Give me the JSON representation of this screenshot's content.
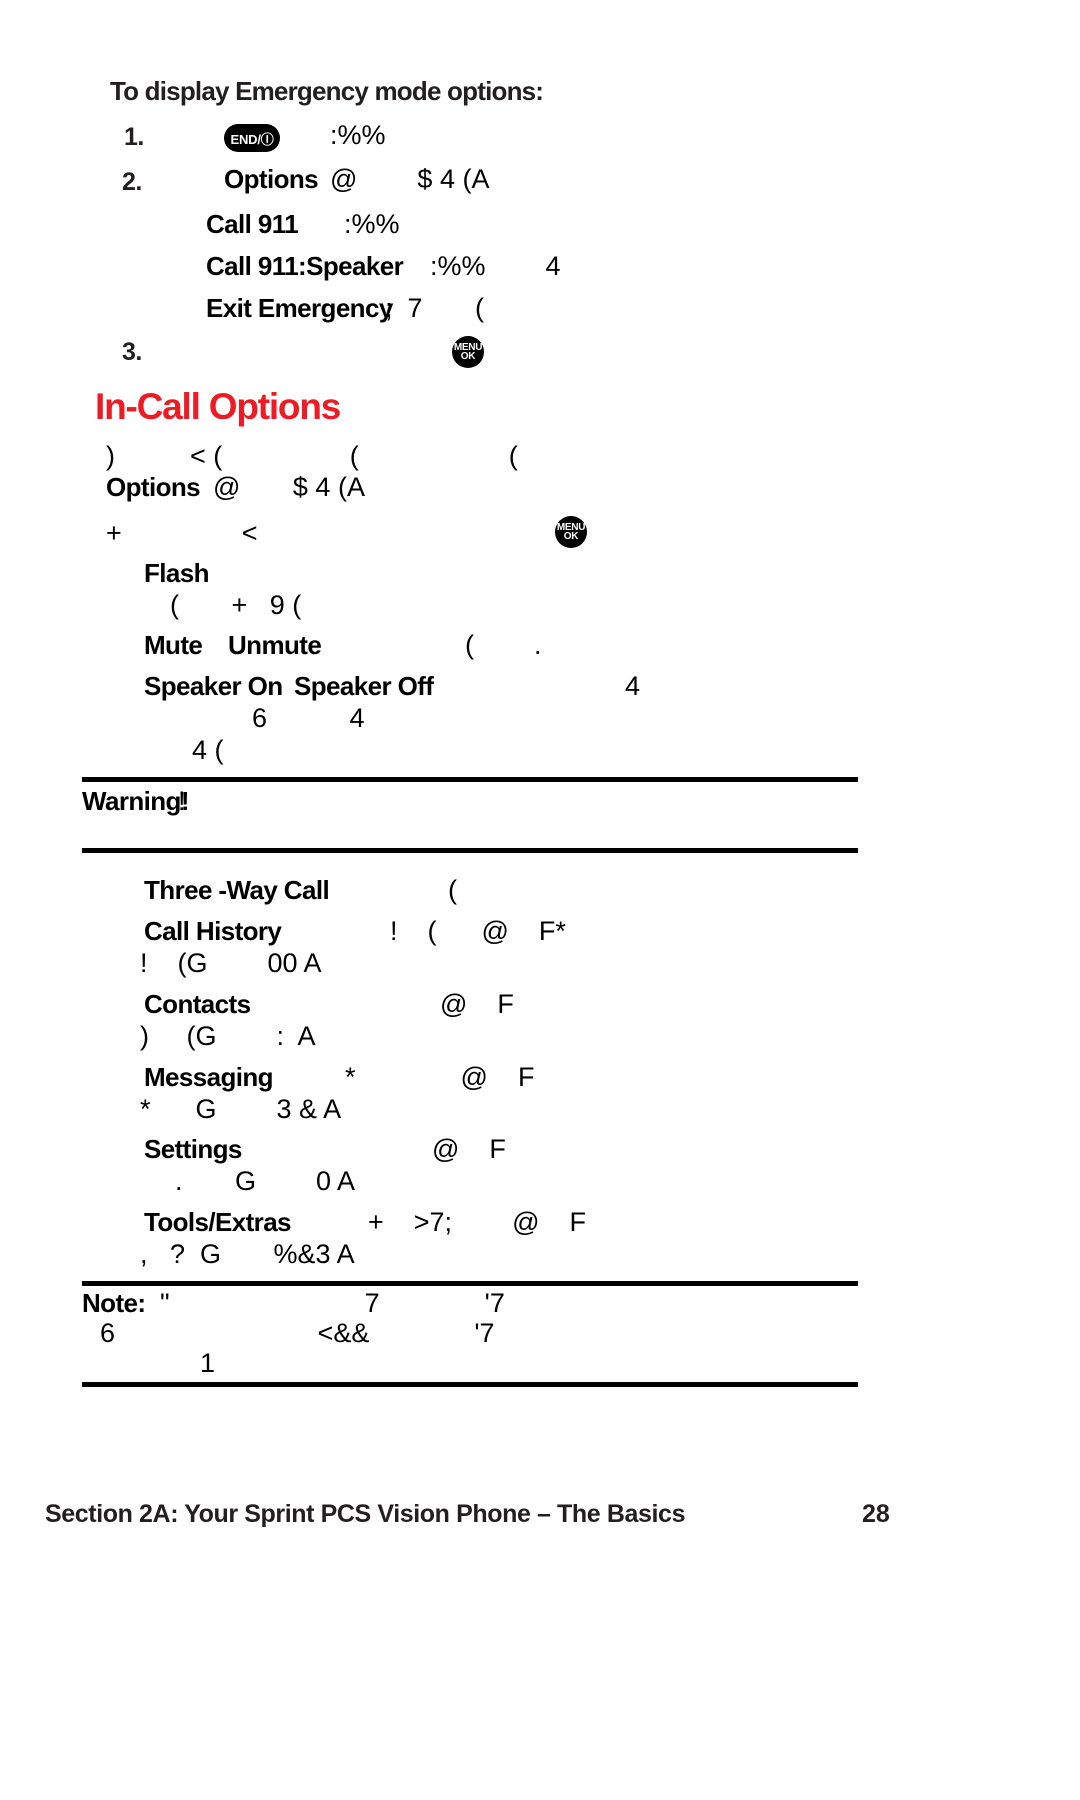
{
  "document": {
    "procedure_title": "To display Emergency mode options:",
    "section_heading": "In-Call Options",
    "section_heading_color": "#ed1c24"
  },
  "icons": {
    "end_key": {
      "label": "END/Ⓘ",
      "name": "end-power-key-icon"
    },
    "menu_key": {
      "line1": "MENU",
      "line2": "OK",
      "name": "menu-ok-key-icon"
    }
  },
  "steps": [
    {
      "number": "1.",
      "bold": "",
      "garbled": ":%%"
    },
    {
      "number": "2.",
      "bold": "Options",
      "garbled": "@        $ 4 (A"
    },
    {
      "number": "3.",
      "bold": "",
      "garbled": ""
    }
  ],
  "emergency_options": [
    {
      "label": "Call 911",
      "garbled": ":%%"
    },
    {
      "label": "Call 911:Speaker",
      "garbled": ":%%        4"
    },
    {
      "label": "Exit Emergency",
      "garbled": ";  7       ("
    }
  ],
  "incall_intro": {
    "line1_garbled": ")          < (                 (                    (",
    "line2_bold": "Options",
    "line2_garbled": "@       $ 4 (A",
    "line3_garbled": "+                <"
  },
  "incall_options": [
    {
      "label": "Flash",
      "garbled": ""
    },
    {
      "label": "",
      "garbled": "(       +   9 ("
    },
    {
      "label": "Mute",
      "label2": "Unmute",
      "garbled": "(        ."
    },
    {
      "label": "Speaker On",
      "label2": "Speaker Off",
      "garbled": "4"
    },
    {
      "label": "",
      "garbled": "6           4"
    },
    {
      "label": "",
      "garbled": "4 ("
    }
  ],
  "warning": {
    "label": "Warning!",
    "garbled": "!"
  },
  "menu_options": [
    {
      "label": "Three -Way Call",
      "garbled": "("
    },
    {
      "label": "Call History",
      "garbled": "!    (      @    F*"
    },
    {
      "label": "",
      "garbled": "!    (G        00 A"
    },
    {
      "label": "Contacts",
      "garbled": "@    F"
    },
    {
      "label": "",
      "garbled": ")     (G        :  A"
    },
    {
      "label": "Messaging",
      "garbled": "*              @    F"
    },
    {
      "label": "",
      "garbled": "*      G        3 & A"
    },
    {
      "label": "Settings",
      "garbled": "@    F"
    },
    {
      "label": "",
      "garbled": ".       G        0 A"
    },
    {
      "label": "Tools/Extras",
      "garbled": "+    >7;        @    F"
    },
    {
      "label": "",
      "garbled": ",   ?  G       %&3 A"
    }
  ],
  "note": {
    "label": "Note:",
    "line1_garbled": "\"                          7              '7",
    "line2_garbled": "6                           <&&              '7",
    "line3_garbled": "1"
  },
  "footer": {
    "section_text": "Section 2A: Your Sprint PCS Vision Phone – The Basics",
    "page_number": "28"
  }
}
